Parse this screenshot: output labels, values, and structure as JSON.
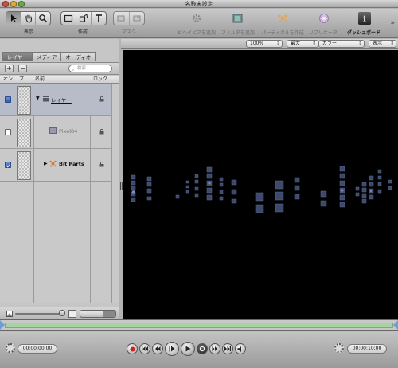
{
  "window": {
    "title": "名称未設定"
  },
  "toolbar": {
    "show_label": "表示",
    "create_label": "作成",
    "mask_label": "マスク",
    "behavior_label": "ビヘイビアを追加",
    "filter_label": "フィルタを追加",
    "particles_label": "パーティクルを作成",
    "replicate_label": "リプリケータ",
    "dashboard_label": "ダッシュボード"
  },
  "panel": {
    "tabs": [
      {
        "label": "レイヤー",
        "selected": true
      },
      {
        "label": "メディア",
        "selected": false
      },
      {
        "label": "オーディオ",
        "selected": false
      }
    ],
    "add_label": "+",
    "remove_label": "−",
    "search_placeholder": "検索",
    "columns": {
      "on": "オン",
      "preview": "プ",
      "name": "名前",
      "lock": "ロック"
    },
    "layers": [
      {
        "name": "レイヤー",
        "enabled": "mixed",
        "indent": 0,
        "expanded": true,
        "dim": false
      },
      {
        "name": "Pixel04",
        "enabled": false,
        "indent": 1,
        "expanded": false,
        "dim": true
      },
      {
        "name": "Bit Parts",
        "enabled": true,
        "indent": 1,
        "expanded": false,
        "dim": false
      }
    ]
  },
  "canvas": {
    "zoom": "100%",
    "resolution": "最大",
    "channels": "カラー",
    "view": "表示"
  },
  "transport": {
    "current_time": "00:00:00;00",
    "duration": "00:00:10;00"
  },
  "colors": {
    "accent": "#2d5cb2",
    "canvas_bg": "#000000",
    "pixel": "#4a5a80",
    "timeline": "#a7d3a0"
  }
}
